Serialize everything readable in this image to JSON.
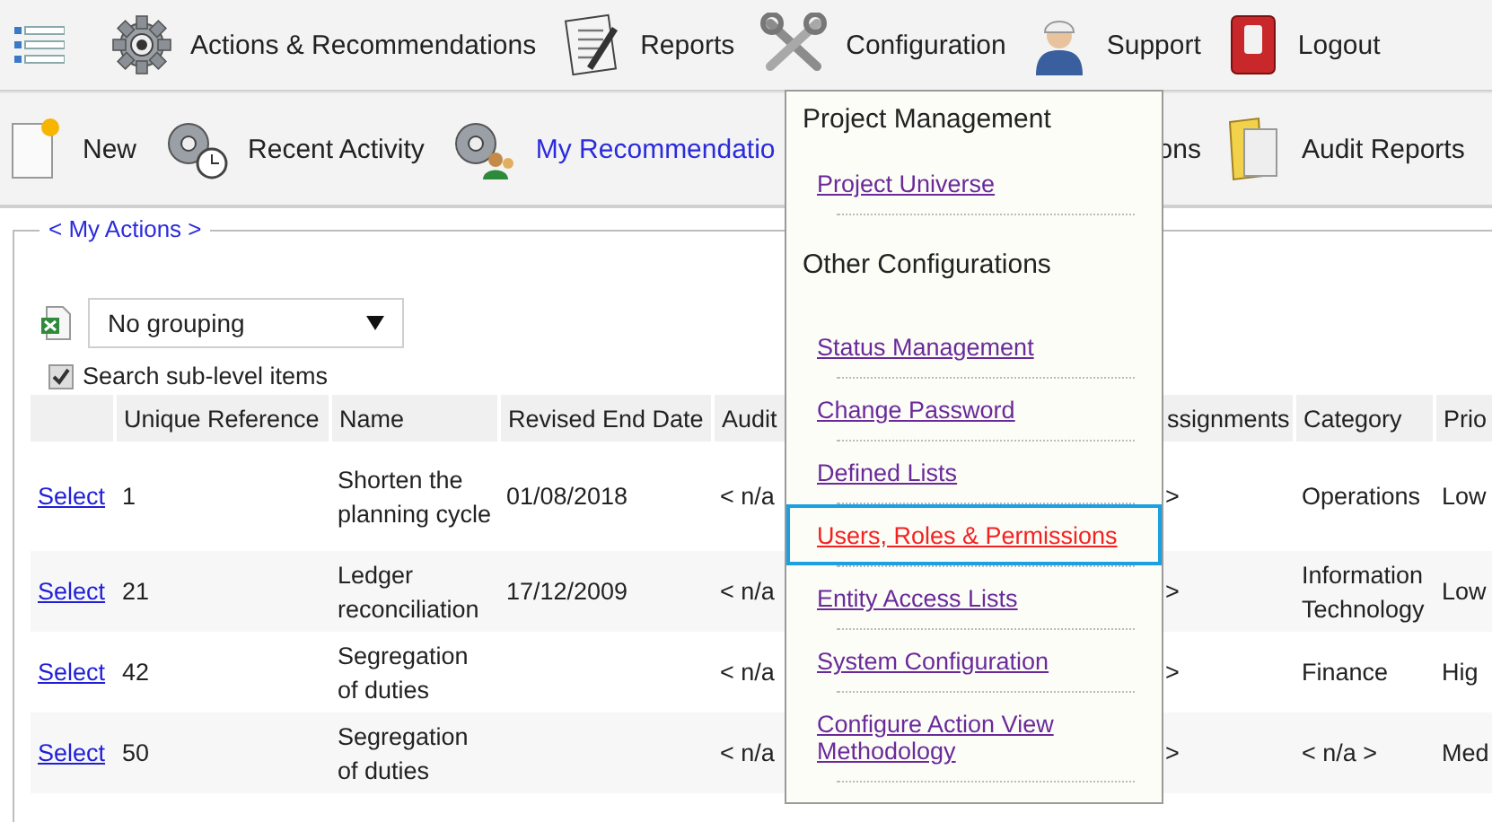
{
  "top_menu": [
    {
      "label": "Actions & Recommendations"
    },
    {
      "label": "Reports"
    },
    {
      "label": "Configuration"
    },
    {
      "label": "Support"
    },
    {
      "label": "Logout"
    }
  ],
  "sub_menu": [
    {
      "label": "New",
      "selected": false
    },
    {
      "label": "Recent Activity",
      "selected": false
    },
    {
      "label": "My Recommendatio",
      "selected": true
    },
    {
      "label": "ons",
      "selected": false
    },
    {
      "label": "Audit Reports",
      "selected": false
    }
  ],
  "panel": {
    "legend": "< My Actions >",
    "grouping": "No grouping",
    "search_sub_level": {
      "label": "Search sub-level items",
      "checked": true
    }
  },
  "table": {
    "columns": [
      "",
      "Unique Reference",
      "Name",
      "Revised End Date",
      "Audit",
      "ssignments",
      "Category",
      "Prio"
    ],
    "rows": [
      [
        "Select",
        "1",
        "Shorten the planning cycle",
        "01/08/2018",
        "< n/a",
        ">",
        "Operations",
        "Low"
      ],
      [
        "Select",
        "21",
        "Ledger reconciliation",
        "17/12/2009",
        "< n/a",
        ">",
        "Information Technology",
        "Low"
      ],
      [
        "Select",
        "42",
        "Segregation of duties",
        "",
        "< n/a",
        ">",
        "Finance",
        "Hig"
      ],
      [
        "Select",
        "50",
        "Segregation of duties",
        "",
        "< n/a",
        ">",
        "< n/a >",
        "Med"
      ]
    ]
  },
  "config_menu": [
    {
      "kind": "heading",
      "label": "Project Management"
    },
    {
      "kind": "link",
      "label": "Project Universe",
      "selected": false
    },
    {
      "kind": "heading",
      "label": "Other Configurations"
    },
    {
      "kind": "link",
      "label": "Status Management",
      "selected": false
    },
    {
      "kind": "link",
      "label": "Change Password",
      "selected": false
    },
    {
      "kind": "link",
      "label": "Defined Lists",
      "selected": false
    },
    {
      "kind": "link",
      "label": "Users, Roles & Permissions",
      "selected": true
    },
    {
      "kind": "link",
      "label": "Entity Access Lists",
      "selected": false
    },
    {
      "kind": "link",
      "label": "System Configuration",
      "selected": false
    },
    {
      "kind": "link",
      "label": "Configure Action View Methodology",
      "selected": false
    }
  ]
}
